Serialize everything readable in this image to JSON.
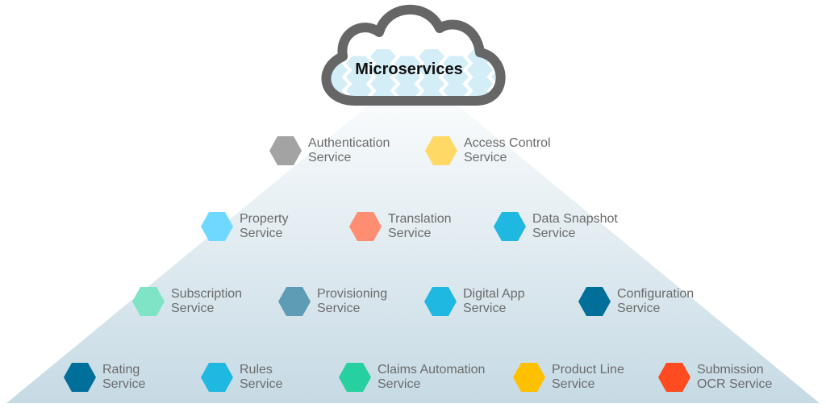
{
  "title": "Microservices",
  "colors": {
    "text": "#6b6b6b",
    "cloud_stroke": "#666666",
    "cloud_hex": "#d4eef7",
    "pyramid_bottom": "#c6dae4"
  },
  "services": [
    {
      "label": "Authentication\nService",
      "color": "#a3a3a3"
    },
    {
      "label": "Access Control\nService",
      "color": "#ffd966"
    },
    {
      "label": "Property\nService",
      "color": "#70d8ff"
    },
    {
      "label": "Translation\nService",
      "color": "#ff8d72"
    },
    {
      "label": "Data Snapshot\nService",
      "color": "#1fb8e0"
    },
    {
      "label": "Subscription\nService",
      "color": "#7fe3c5"
    },
    {
      "label": "Provisioning\nService",
      "color": "#5e9bb5"
    },
    {
      "label": "Digital App\nService",
      "color": "#1fb8e0"
    },
    {
      "label": "Configuration\nService",
      "color": "#006f99"
    },
    {
      "label": "Rating\nService",
      "color": "#006f99"
    },
    {
      "label": "Rules\nService",
      "color": "#1fb8e0"
    },
    {
      "label": "Claims Automation\nService",
      "color": "#26d09f"
    },
    {
      "label": "Product Line\nService",
      "color": "#ffc000"
    },
    {
      "label": "Submission\nOCR Service",
      "color": "#ff4b1f"
    }
  ]
}
